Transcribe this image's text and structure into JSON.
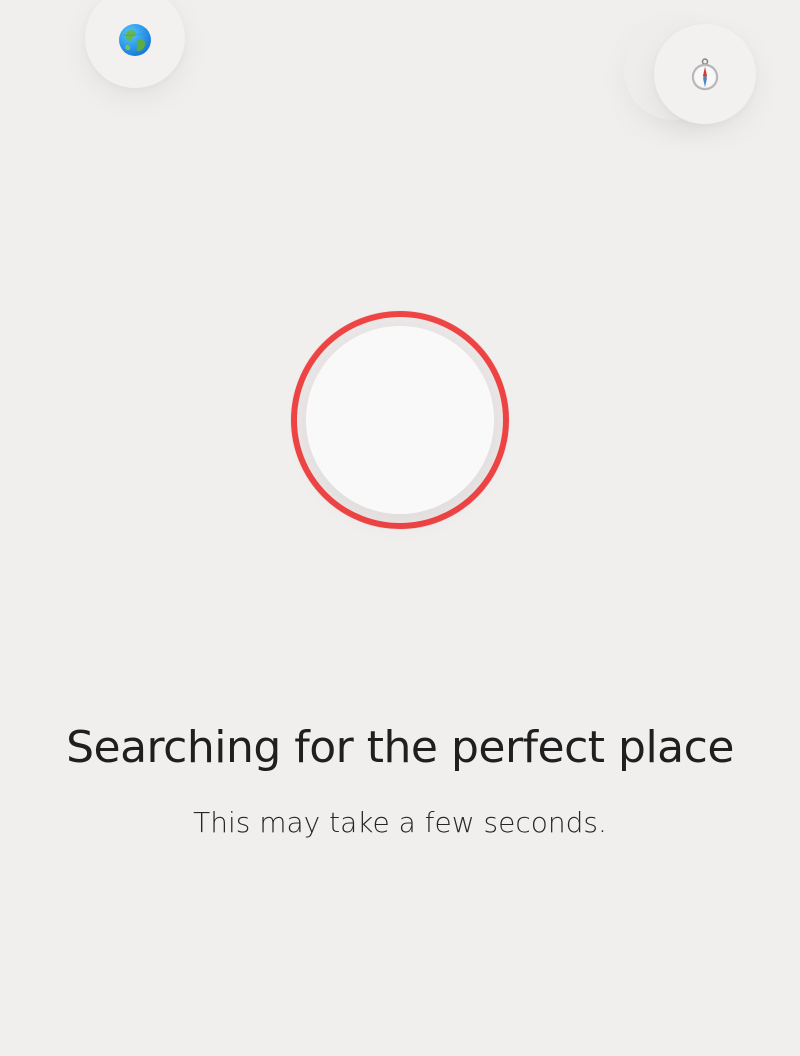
{
  "icons": {
    "globe": "globe-icon",
    "compass": "compass-icon"
  },
  "colors": {
    "background": "#f1efee",
    "accent": "#ef4444",
    "text": "#1f1f1f"
  },
  "loading": {
    "title": "Searching for the perfect place",
    "subtitle": "This may take a few seconds."
  }
}
